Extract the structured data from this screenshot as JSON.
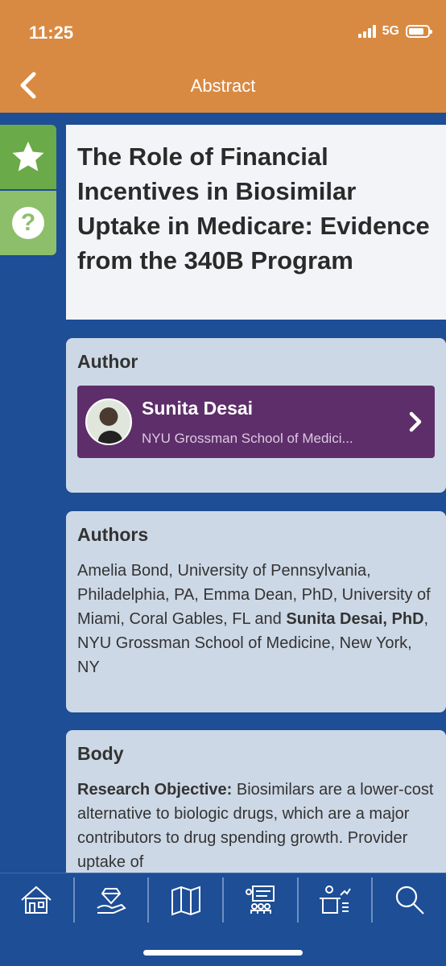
{
  "status": {
    "time": "11:25",
    "network": "5G"
  },
  "header": {
    "title": "Abstract"
  },
  "article": {
    "title": "The Role of Financial Incentives in Biosimilar Uptake in Medicare: Evidence from the 340B Program"
  },
  "author_section": {
    "heading": "Author",
    "name": "Sunita Desai",
    "affiliation": "NYU Grossman School of Medici..."
  },
  "authors_section": {
    "heading": "Authors",
    "text_part1": "Amelia Bond, University of Pennsylvania, Philadelphia, PA, Emma Dean, PhD, University of Miami, Coral Gables, FL and ",
    "text_bold": "Sunita Desai, PhD",
    "text_part2": ", NYU Grossman School of Medicine, New York, NY"
  },
  "body_section": {
    "heading": "Body",
    "objective_label": "Research Objective:",
    "objective_text": " Biosimilars are a lower-cost alternative to biologic drugs, which are a major contributors to drug spending growth. Provider uptake of"
  },
  "tabs": [
    {
      "icon": "home-icon"
    },
    {
      "icon": "sponsor-icon"
    },
    {
      "icon": "map-icon"
    },
    {
      "icon": "schedule-icon"
    },
    {
      "icon": "presentation-icon"
    },
    {
      "icon": "search-icon"
    }
  ],
  "colors": {
    "header": "#d98a42",
    "background": "#1d4e96",
    "card": "#cdd8e6",
    "author_row": "#5e2e6a",
    "star_button": "#6aaa48",
    "help_button": "#8dbf6a"
  }
}
